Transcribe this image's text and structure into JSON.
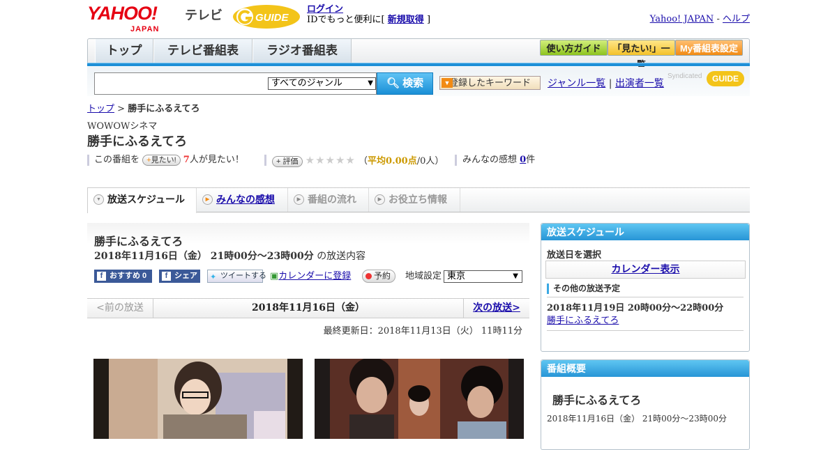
{
  "header": {
    "yahoo_logo": "YAHOO!",
    "yahoo_japan": "JAPAN",
    "tv_label": "テレビ",
    "gguide_logo": "G-GUIDE",
    "login_link": "ログイン",
    "login_text": "IDでもっと便利に[",
    "signup_link": "新規取得",
    "signup_close": "]",
    "yahoo_japan_link": "Yahoo! JAPAN",
    "separator": "-",
    "help_link": "ヘルプ"
  },
  "nav": {
    "tabs": [
      "トップ",
      "テレビ番組表",
      "ラジオ番組表"
    ],
    "guide_button": "使い方ガイド",
    "mitai_button": "「見たい!」一覧",
    "my_button": "My番組表設定"
  },
  "search": {
    "genre_select": "すべてのジャンル",
    "search_button": "検索",
    "keyword_button": "登録したキーワード",
    "genre_list_link": "ジャンル一覧",
    "link_sep": "|",
    "performer_link": "出演者一覧",
    "syndicated": "Syndicated",
    "syndicated_logo": "GUIDE"
  },
  "breadcrumb": {
    "top": "トップ",
    "sep": ">",
    "current": "勝手にふるえてろ"
  },
  "program": {
    "channel": "WOWOWシネマ",
    "title": "勝手にふるえてろ",
    "mitai_prefix": "この番組を",
    "mitai_button": "見たい!",
    "mitai_count": "7",
    "mitai_suffix": "人が見たい！",
    "rating_button": "評価",
    "stars": "★★★★★",
    "avg_prefix": "（",
    "avg_label": "平均0.00点",
    "avg_suffix": "/0人）",
    "impressions_label": "みんなの感想",
    "impressions_count": "0",
    "impressions_unit": "件"
  },
  "subtabs": [
    "放送スケジュール",
    "みんなの感想",
    "番組の流れ",
    "お役立ち情報"
  ],
  "main": {
    "title": "勝手にふるえてろ",
    "datetime": "2018年11月16日（金）  21時00分～23時00分",
    "datetime_suffix": "の放送内容",
    "fb_recommend": "おすすめ 0",
    "fb_share": "シェア",
    "tweet": "ツイートする",
    "calendar_register": "カレンダーに登録",
    "reserve": "予約",
    "region_label": "地域設定",
    "region_value": "東京",
    "prev": "<前の放送",
    "current_date": "2018年11月16日（金）",
    "next": "次の放送>",
    "last_updated": "最終更新日：2018年11月13日（火）  11時11分"
  },
  "side_schedule": {
    "header": "放送スケジュール",
    "select_label": "放送日を選択",
    "calendar_button": "カレンダー表示",
    "other_label": "その他の放送予定",
    "other_datetime": "2018年11月19日  20時00分～22時00分",
    "other_title": "勝手にふるえてろ"
  },
  "side_overview": {
    "header": "番組概要",
    "title": "勝手にふるえてろ",
    "datetime": "2018年11月16日（金）  21時00分～23時00分"
  },
  "colors": {
    "accent_blue": "#1e90d7",
    "yahoo_red": "#e60012",
    "gguide_yellow": "#f3c419",
    "link": "#1a0dab"
  }
}
